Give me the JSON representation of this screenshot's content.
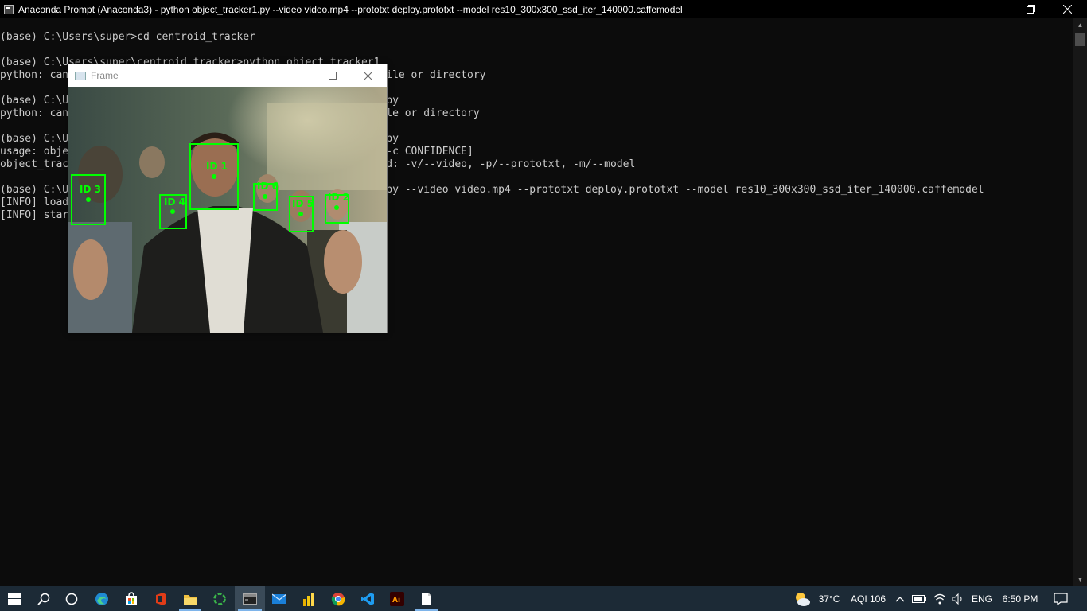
{
  "window": {
    "title": "Anaconda Prompt (Anaconda3) - python  object_tracker1.py --video video.mp4 --prototxt deploy.prototxt --model res10_300x300_ssd_iter_140000.caffemodel",
    "minimize_icon": "minimize-icon",
    "restore_icon": "restore-icon",
    "close_icon": "close-icon"
  },
  "console": {
    "lines": [
      "(base) C:\\Users\\super>cd centroid_tracker",
      "",
      "(base) C:\\Users\\super\\centroid_tracker>python object_tracker1",
      "python: can't open file 'object_tracker1': [Errno 2] No such file or directory",
      "",
      "(base) C:\\Users\\super\\centroid_tracker>python object_tracker .py",
      "python: can't open file 'object_tracker': [Errno 2] No such file or directory",
      "",
      "(base) C:\\Users\\super\\centroid_tracker>python object_tracker1.py",
      "usage: object_tracker1.py [-h] -v VIDEO -p PROTOTXT -m MODEL [-c CONFIDENCE]",
      "object_tracker1.py: error: the following arguments are required: -v/--video, -p/--prototxt, -m/--model",
      "",
      "(base) C:\\Users\\super\\centroid_tracker>python object_tracker1.py --video video.mp4 --prototxt deploy.prototxt --model res10_300x300_ssd_iter_140000.caffemodel",
      "[INFO] loading model...",
      "[INFO] starting video stream..."
    ],
    "text_color": "#cccccc",
    "background": "#0c0c0c"
  },
  "frame_window": {
    "title": "Frame",
    "detections": [
      "ID 1",
      "ID 2",
      "ID 3",
      "ID 4",
      "ID 5",
      "ID 6"
    ],
    "box_color": "#00ff00"
  },
  "taskbar": {
    "apps": [
      {
        "name": "start",
        "icon": "windows-logo-icon"
      },
      {
        "name": "search",
        "icon": "search-icon"
      },
      {
        "name": "task-view",
        "icon": "task-view-icon"
      },
      {
        "name": "edge",
        "icon": "edge-icon"
      },
      {
        "name": "store",
        "icon": "store-icon"
      },
      {
        "name": "office",
        "icon": "office-icon"
      },
      {
        "name": "file-explorer",
        "icon": "folder-icon"
      },
      {
        "name": "sync",
        "icon": "sync-icon"
      },
      {
        "name": "anaconda-prompt",
        "icon": "terminal-icon"
      },
      {
        "name": "mail",
        "icon": "mail-icon"
      },
      {
        "name": "power-bi",
        "icon": "chart-icon"
      },
      {
        "name": "chrome",
        "icon": "chrome-icon"
      },
      {
        "name": "vscode",
        "icon": "vscode-icon"
      },
      {
        "name": "illustrator",
        "icon": "illustrator-icon"
      },
      {
        "name": "notepad",
        "icon": "document-icon"
      }
    ],
    "weather_temp": "37°C",
    "aqi": "AQI 106",
    "language": "ENG",
    "time": "6:50 PM"
  }
}
